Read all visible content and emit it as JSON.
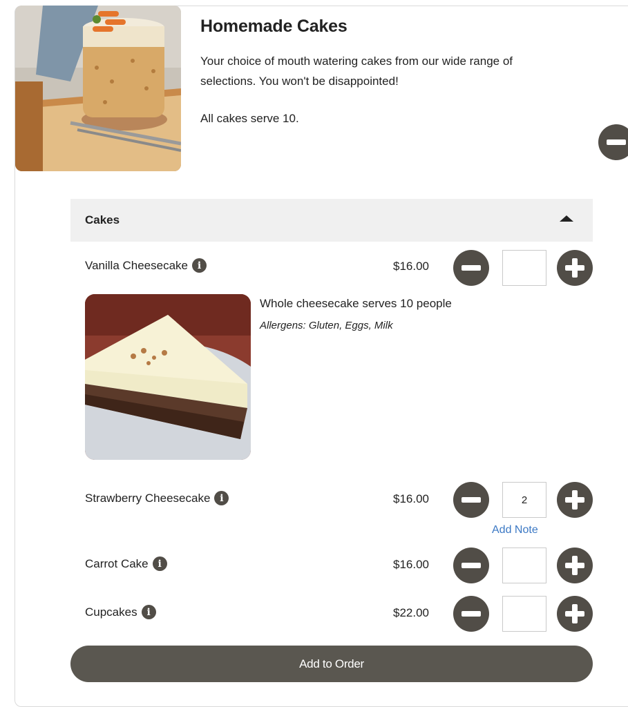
{
  "category": {
    "title": "Homemade Cakes",
    "description": "Your choice of mouth watering cakes from our wide range of selections. You won't be disappointed!",
    "serves_note": "All cakes serve 10."
  },
  "section": {
    "title": "Cakes"
  },
  "items": [
    {
      "name": "Vanilla Cheesecake",
      "price": "$16.00",
      "quantity": ""
    },
    {
      "name": "Strawberry Cheesecake",
      "price": "$16.00",
      "quantity": "2",
      "note_link": "Add Note"
    },
    {
      "name": "Carrot Cake",
      "price": "$16.00",
      "quantity": ""
    },
    {
      "name": "Cupcakes",
      "price": "$22.00",
      "quantity": ""
    }
  ],
  "expanded_item": {
    "description": "Whole cheesecake serves 10 people",
    "allergens": "Allergens: Gluten, Eggs, Milk"
  },
  "actions": {
    "add_to_order": "Add to Order"
  },
  "icons": {
    "info": "info-icon",
    "minus": "minus-icon",
    "plus": "plus-icon",
    "collapse": "collapse-minus-icon",
    "section_toggle": "caret-up-icon"
  },
  "colors": {
    "button_dark": "#514d47",
    "add_to_order_bg": "#5a5750",
    "link": "#3b78c4",
    "section_header_bg": "#f0f0f0"
  }
}
